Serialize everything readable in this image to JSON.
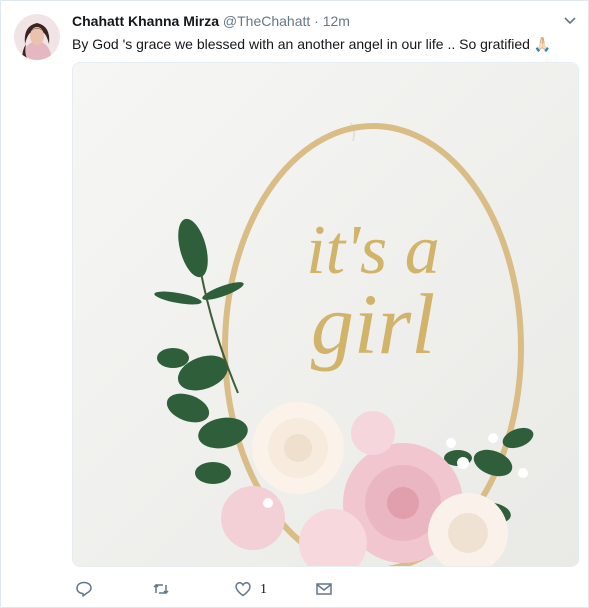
{
  "tweet": {
    "author_name": "Chahatt Khanna Mirza",
    "handle": "@TheChahatt",
    "separator": "·",
    "time": "12m",
    "text": "By God 's grace we blessed with an another angel in our life .. So gratified",
    "emoji": "🙏🏻",
    "media_text": [
      "it's a",
      "girl"
    ],
    "actions": {
      "reply_icon": "reply-icon",
      "retweet_icon": "retweet-icon",
      "like_icon": "heart-icon",
      "like_count": "1",
      "dm_icon": "envelope-icon"
    }
  },
  "colors": {
    "text": "#14171a",
    "secondary": "#657786",
    "border": "#e1e8ed"
  }
}
